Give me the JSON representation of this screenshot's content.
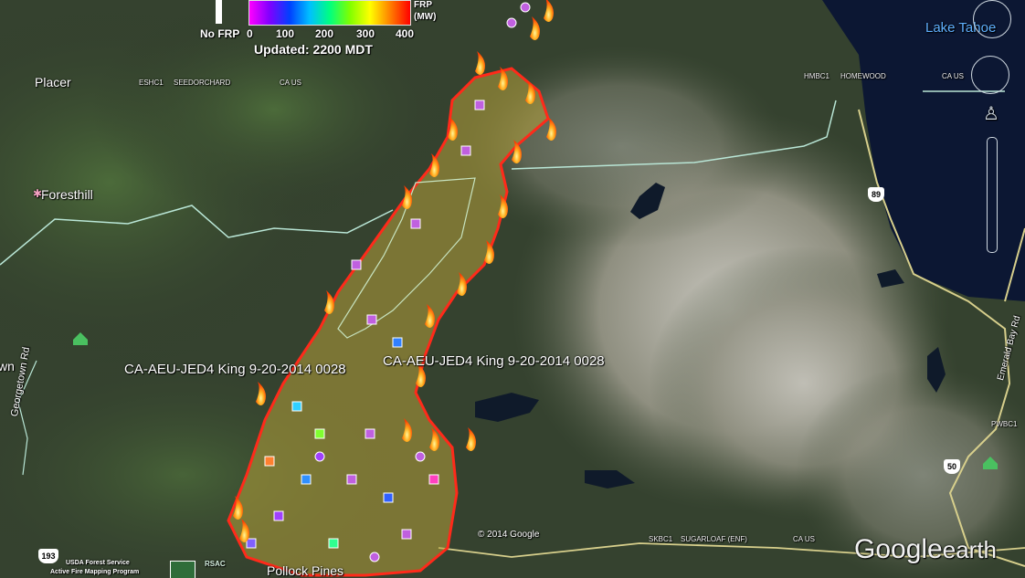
{
  "legend": {
    "no_frp_label": "No FRP",
    "frp_title": "FRP",
    "frp_unit": "(MW)",
    "ticks": [
      "0",
      "100",
      "200",
      "300",
      "400"
    ],
    "updated": "Updated: 2200 MDT"
  },
  "places": {
    "placer": "Placer",
    "foresthill": "Foresthill",
    "lake_tahoe": "Lake Tahoe",
    "pollock_pines": "Pollock Pines",
    "georgetown": "Georgetown Rd",
    "emerald_bay": "Emerald Bay Rd",
    "own": "wn"
  },
  "small_labels": {
    "eshc1": "ESHC1",
    "seedorchard": "SEEDORCHARD",
    "ca_us_1": "CA US",
    "hmbc1": "HMBC1",
    "homewood": "HOMEWOOD",
    "ca_us_2": "CA US",
    "pwbc1": "PWBC1",
    "skbc1": "SKBC1",
    "sugarloaf": "SUGARLOAF (ENF)",
    "ca_us_3": "CA US"
  },
  "fire_labels": {
    "left": "CA-AEU-JED4 King 9-20-2014 0028",
    "right": "CA-AEU-JED4 King 9-20-2014 0028"
  },
  "highways": {
    "h89": "89",
    "h50": "50",
    "h193": "193"
  },
  "credits": {
    "copyright": "© 2014 Google",
    "usfs_line1": "USDA Forest Service",
    "usfs_line2": "Active Fire Mapping Program",
    "rsac": "RSAC",
    "google_earth_google": "Google",
    "google_earth_earth": "earth"
  },
  "colors": {
    "fire_perimeter": "#ff2a1a",
    "burn_fill": "#b5a13a",
    "lake": "#0c1733"
  }
}
